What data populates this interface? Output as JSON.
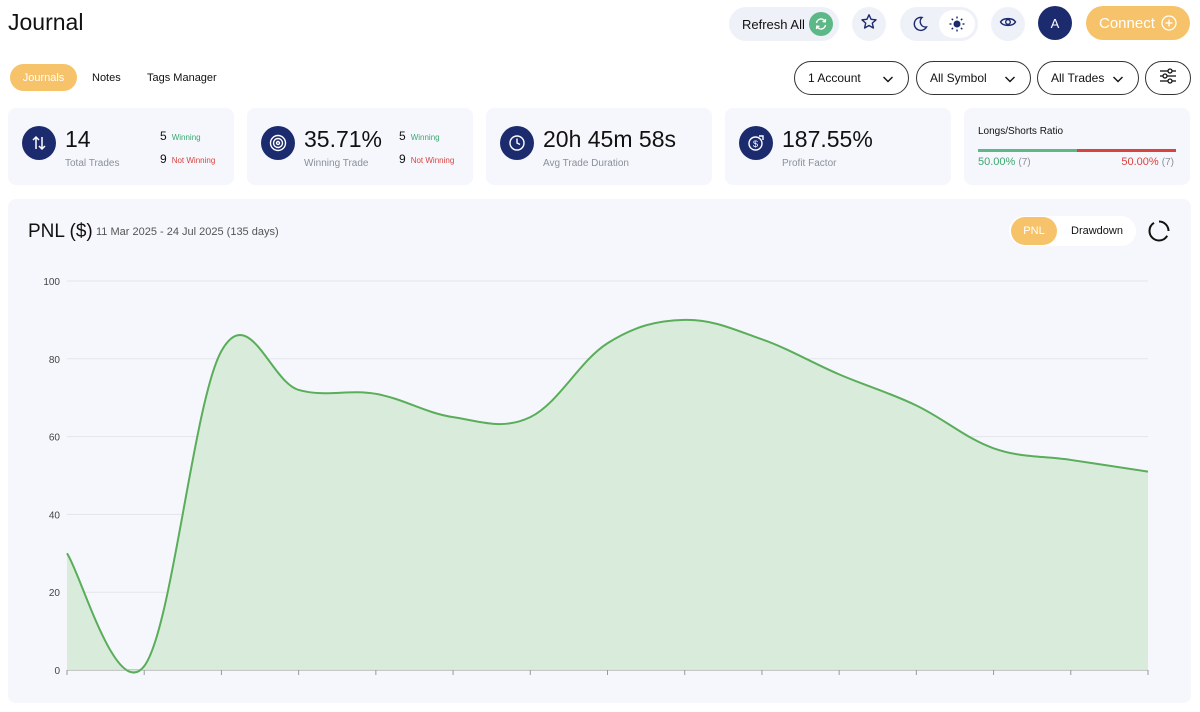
{
  "header": {
    "title": "Journal",
    "refresh_label": "Refresh All",
    "avatar_initial": "A",
    "connect_label": "Connect"
  },
  "tabs": [
    {
      "label": "Journals",
      "active": true
    },
    {
      "label": "Notes",
      "active": false
    },
    {
      "label": "Tags Manager",
      "active": false
    }
  ],
  "filters": {
    "account": "1 Account",
    "symbol": "All Symbol",
    "trades": "All Trades"
  },
  "stats": {
    "total_trades": {
      "value": "14",
      "label": "Total Trades",
      "winning_count": "5",
      "winning_label": "Winning",
      "not_winning_count": "9",
      "not_winning_label": "Not Winning"
    },
    "winning_trade": {
      "value": "35.71%",
      "label": "Winning Trade",
      "winning_count": "5",
      "winning_label": "Winning",
      "not_winning_count": "9",
      "not_winning_label": "Not Winning"
    },
    "avg_duration": {
      "value": "20h 45m 58s",
      "label": "Avg Trade Duration"
    },
    "profit_factor": {
      "value": "187.55%",
      "label": "Profit Factor"
    },
    "ratio": {
      "title": "Longs/Shorts Ratio",
      "long_pct": "50.00%",
      "long_count": "(7)",
      "short_pct": "50.00%",
      "short_count": "(7)",
      "long_fraction": 0.5
    }
  },
  "chart_panel": {
    "title": "PNL ($)",
    "range": "11 Mar 2025 - 24 Jul 2025 (135 days)",
    "toggle_active": "PNL",
    "toggle_other": "Drawdown"
  },
  "colors": {
    "accent": "#f6c36a",
    "navy": "#1c2b6e",
    "green": "#5cb887",
    "red": "#d9433e",
    "line": "#5aad5a",
    "fill": "#d6ead7"
  },
  "icons": [
    "sync-icon",
    "star-icon",
    "moon-icon",
    "sun-icon",
    "eye-icon",
    "plus-circle-icon",
    "chevron-down-icon",
    "sliders-icon",
    "arrows-updown-icon",
    "target-icon",
    "clock-icon",
    "dollar-growth-icon",
    "reset-icon"
  ],
  "chart_data": {
    "type": "area",
    "title": "PNL ($)",
    "x": [
      0,
      1,
      2,
      3,
      4,
      5,
      6,
      7,
      8,
      9,
      10,
      11,
      12,
      13
    ],
    "values": [
      30,
      1,
      82,
      72,
      71,
      65,
      65,
      84,
      90,
      85,
      76,
      68,
      57,
      54,
      51
    ],
    "y_ticks": [
      0,
      20,
      40,
      60,
      80,
      100
    ],
    "ylim": [
      0,
      100
    ],
    "grid": true,
    "xlabel": "",
    "ylabel": ""
  }
}
